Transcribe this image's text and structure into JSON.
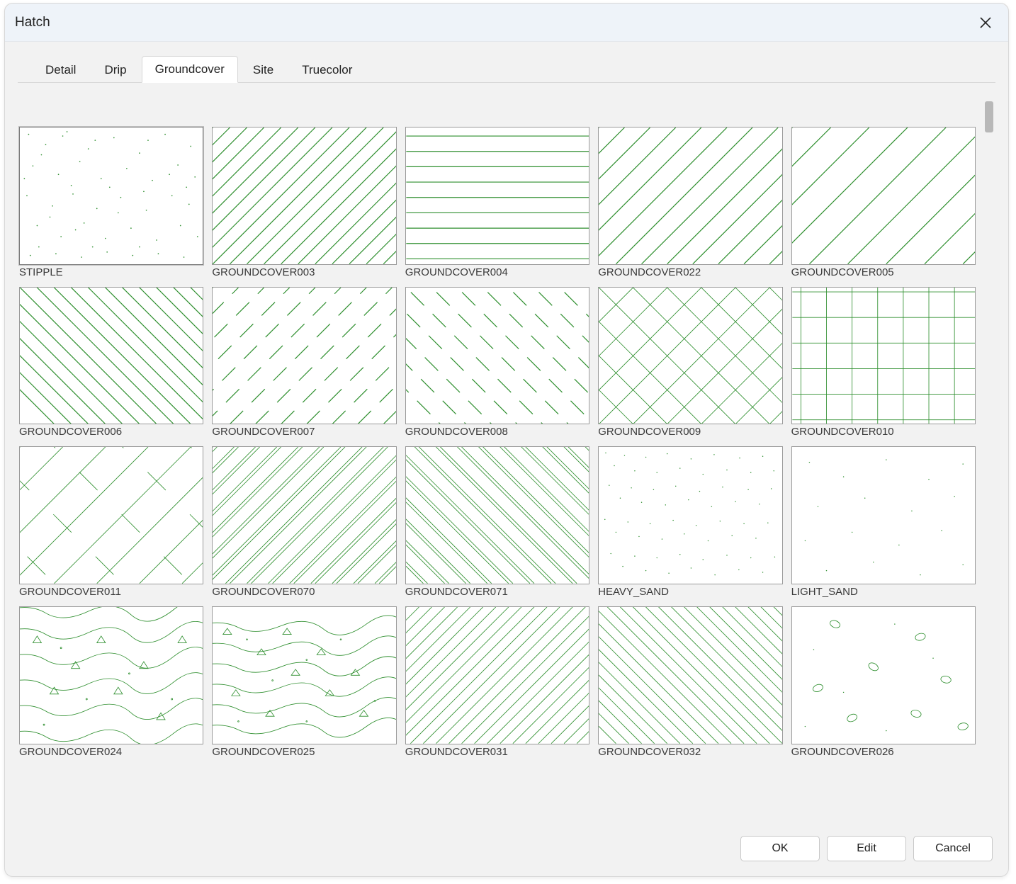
{
  "window": {
    "title": "Hatch"
  },
  "tabs": [
    {
      "label": "Detail",
      "active": false
    },
    {
      "label": "Drip",
      "active": false
    },
    {
      "label": "Groundcover",
      "active": true
    },
    {
      "label": "Site",
      "active": false
    },
    {
      "label": "Truecolor",
      "active": false
    }
  ],
  "patterns": [
    {
      "label": "STIPPLE",
      "selected": true
    },
    {
      "label": "GROUNDCOVER003",
      "selected": false
    },
    {
      "label": "GROUNDCOVER004",
      "selected": false
    },
    {
      "label": "GROUNDCOVER022",
      "selected": false
    },
    {
      "label": "GROUNDCOVER005",
      "selected": false
    },
    {
      "label": "GROUNDCOVER006",
      "selected": false
    },
    {
      "label": "GROUNDCOVER007",
      "selected": false
    },
    {
      "label": "GROUNDCOVER008",
      "selected": false
    },
    {
      "label": "GROUNDCOVER009",
      "selected": false
    },
    {
      "label": "GROUNDCOVER010",
      "selected": false
    },
    {
      "label": "GROUNDCOVER011",
      "selected": false
    },
    {
      "label": "GROUNDCOVER070",
      "selected": false
    },
    {
      "label": "GROUNDCOVER071",
      "selected": false
    },
    {
      "label": "HEAVY_SAND",
      "selected": false
    },
    {
      "label": "LIGHT_SAND",
      "selected": false
    },
    {
      "label": "GROUNDCOVER024",
      "selected": false
    },
    {
      "label": "GROUNDCOVER025",
      "selected": false
    },
    {
      "label": "GROUNDCOVER031",
      "selected": false
    },
    {
      "label": "GROUNDCOVER032",
      "selected": false
    },
    {
      "label": "GROUNDCOVER026",
      "selected": false
    }
  ],
  "buttons": {
    "ok": "OK",
    "edit": "Edit",
    "cancel": "Cancel"
  },
  "colors": {
    "hatch_stroke": "#2f8f2f"
  }
}
